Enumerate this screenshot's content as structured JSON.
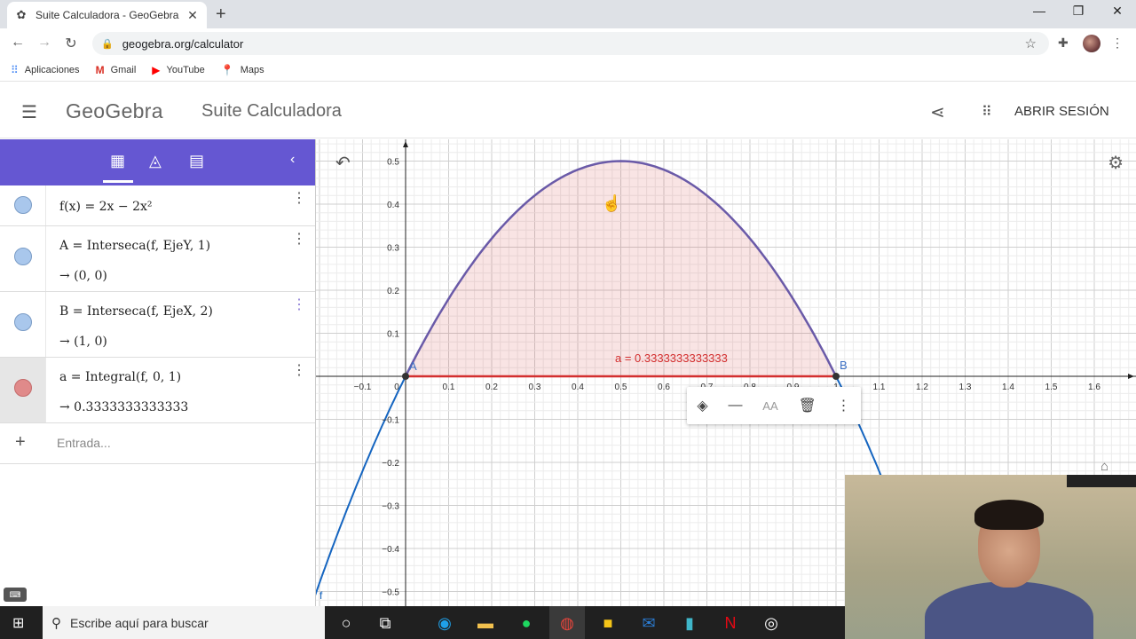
{
  "browser": {
    "tab_title": "Suite Calculadora - GeoGebra",
    "url": "geogebra.org/calculator",
    "bookmarks": [
      {
        "label": "Aplicaciones",
        "icon": "apps-grid-icon",
        "color": "#4285f4"
      },
      {
        "label": "Gmail",
        "icon": "gmail-icon",
        "color": "#d93025"
      },
      {
        "label": "YouTube",
        "icon": "youtube-icon",
        "color": "#ff0000"
      },
      {
        "label": "Maps",
        "icon": "maps-pin-icon",
        "color": "#34a853"
      }
    ]
  },
  "header": {
    "logo": "GeoGebra",
    "app_name": "Suite Calculadora",
    "login": "ABRIR SESIÓN"
  },
  "algebra": {
    "accent": "#6557d2",
    "rows": [
      {
        "def": "f(x) = 2x − 2x²",
        "output": ""
      },
      {
        "def": "A = Interseca(f, EjeY, 1)",
        "output": "→ (0, 0)"
      },
      {
        "def": "B = Interseca(f, EjeX, 2)",
        "output": "→ (1, 0)"
      },
      {
        "def": "a = Integral(f, 0, 1)",
        "output": "→ 0.3333333333333"
      }
    ],
    "input_placeholder": "Entrada..."
  },
  "graph": {
    "area_label": "a = 0.3333333333333",
    "point_A": "A",
    "point_B": "B",
    "curve_label": "f",
    "x_ticks": [
      "−0.1",
      "0",
      "0.1",
      "0.2",
      "0.3",
      "0.4",
      "0.5",
      "0.6",
      "0.7",
      "0.8",
      "0.9",
      "1",
      "1.1",
      "1.2",
      "1.3",
      "1.4",
      "1.5",
      "1.6"
    ],
    "y_ticks": [
      "0.5",
      "0.4",
      "0.3",
      "0.2",
      "0.1",
      "−0.1",
      "−0.2",
      "−0.3",
      "−0.4",
      "−0.5"
    ],
    "curve_color": "#1565c0",
    "area_color": "#d32f2f"
  },
  "taskbar": {
    "search_placeholder": "Escribe aquí para buscar"
  }
}
